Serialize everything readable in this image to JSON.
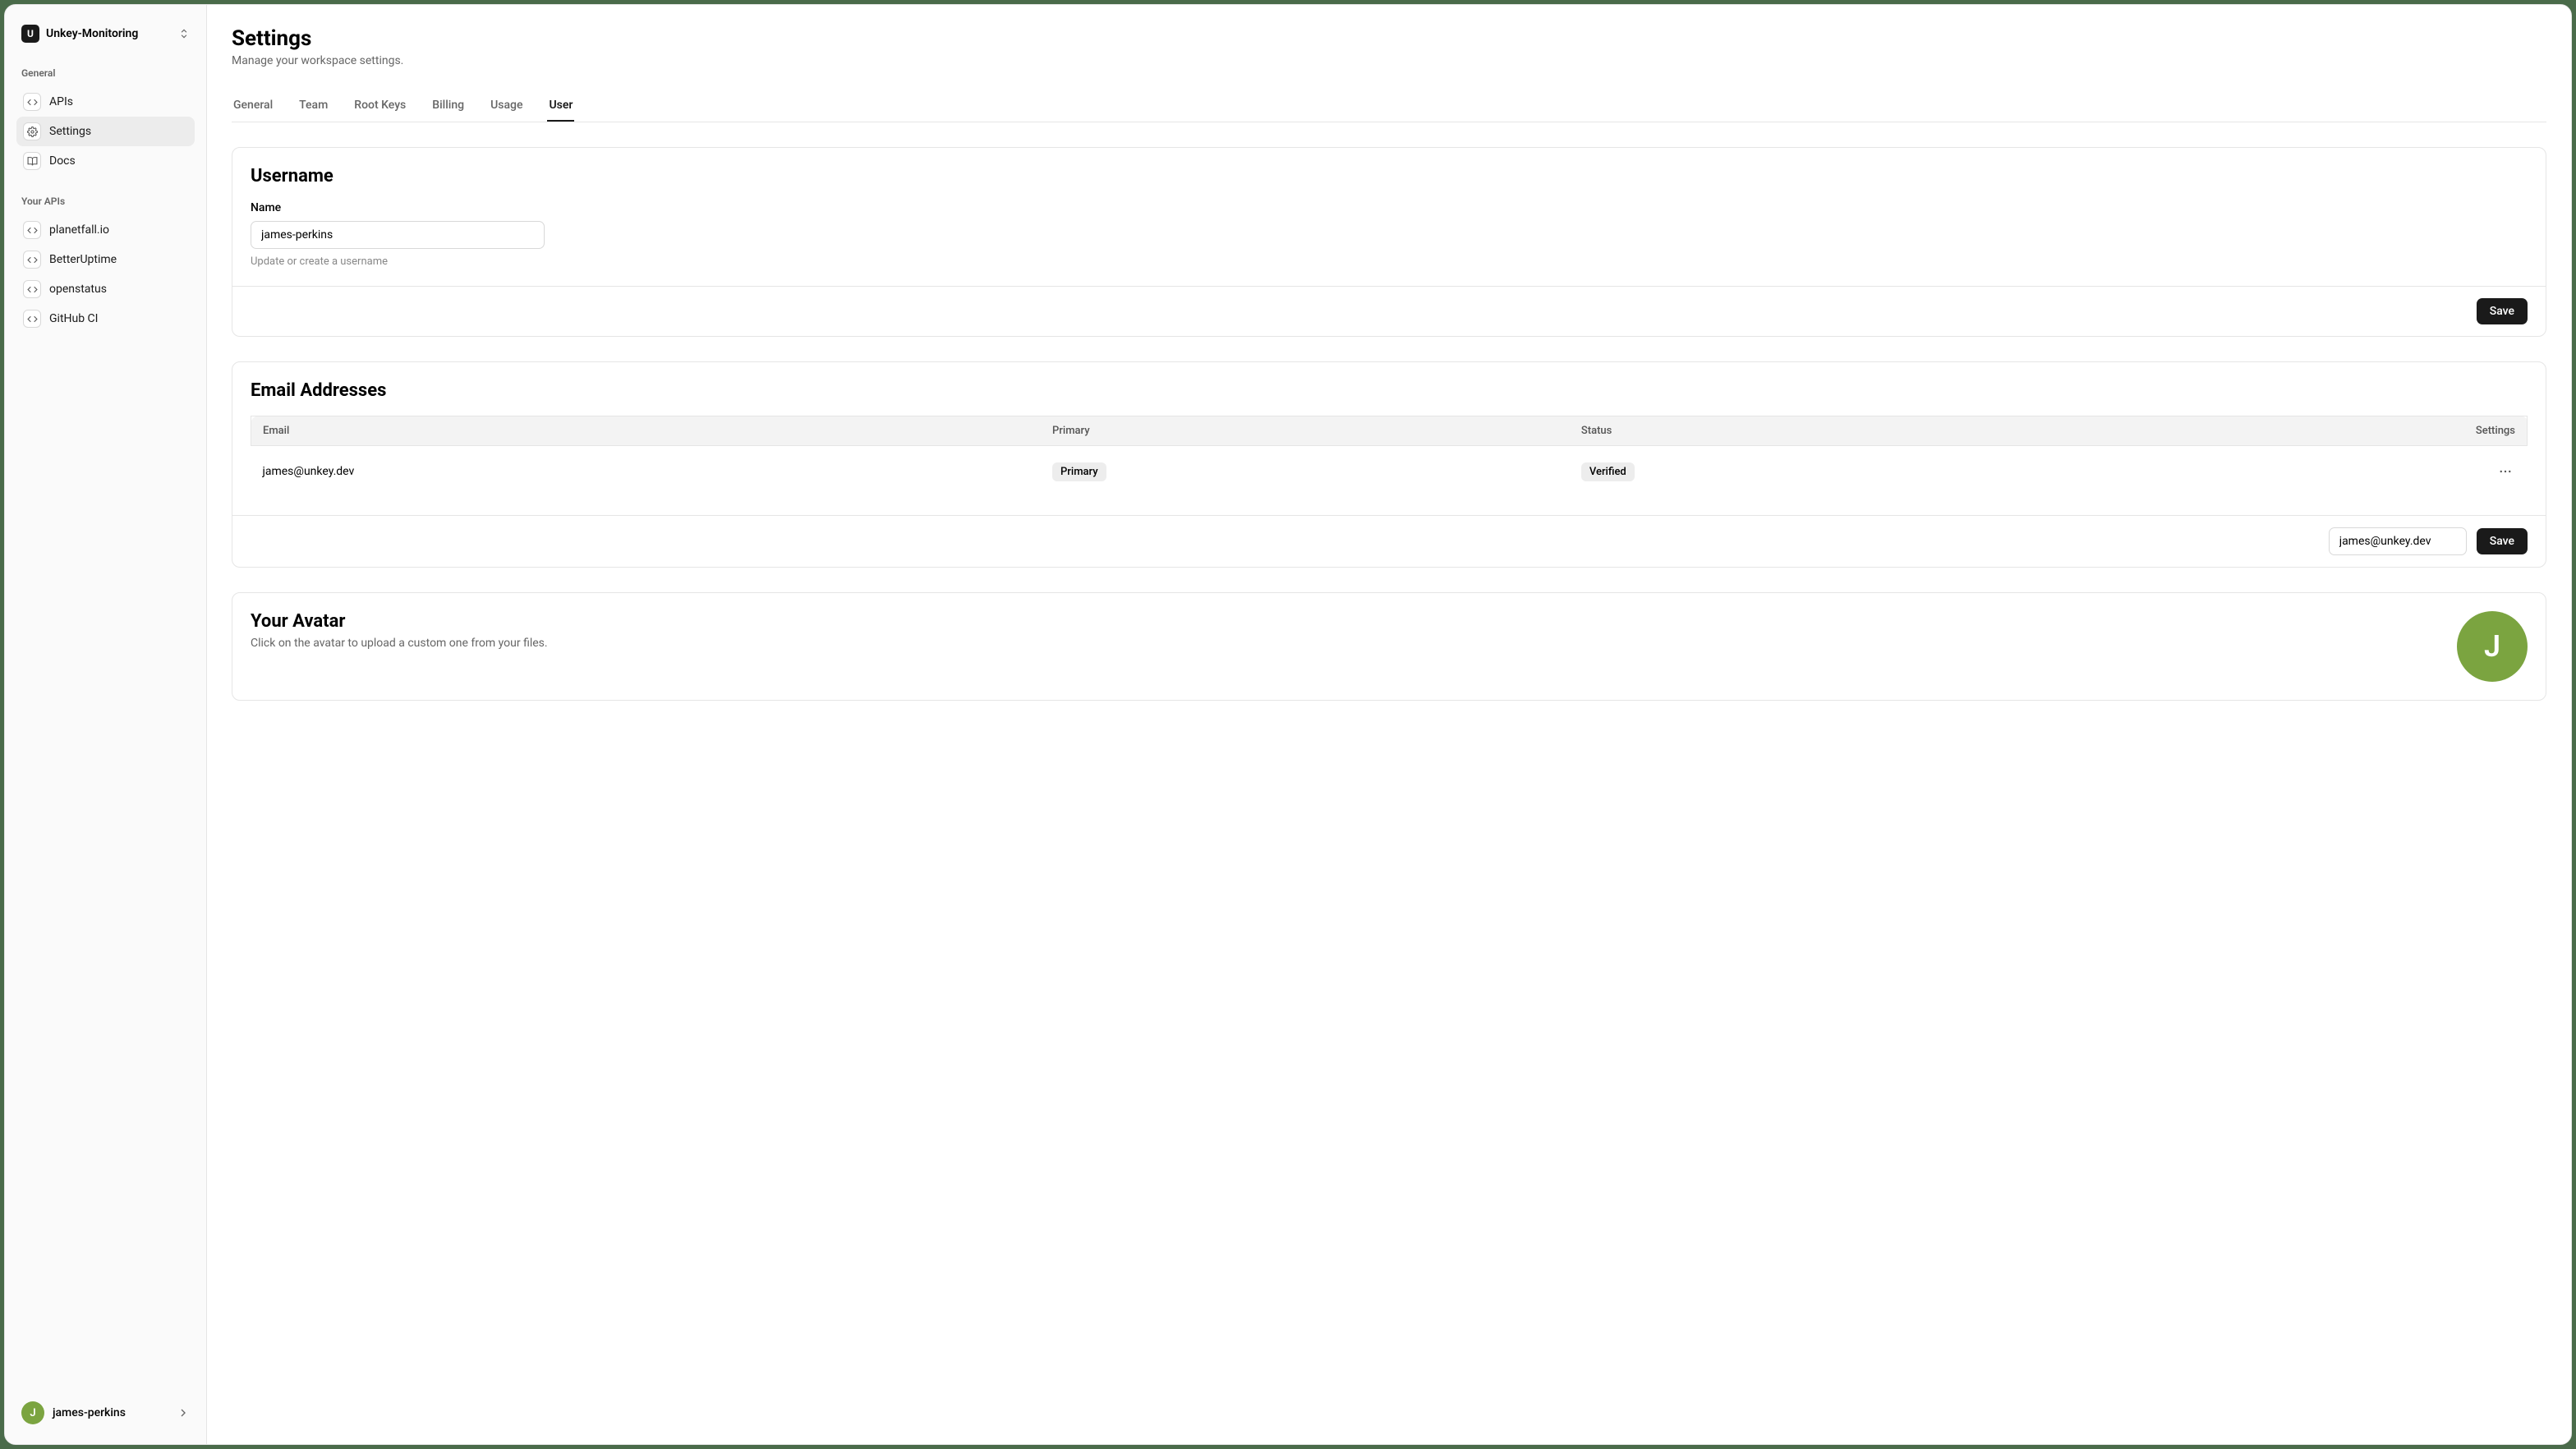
{
  "workspace": {
    "name": "Unkey-Monitoring",
    "logo_letter": "U"
  },
  "sidebar": {
    "section_general": "General",
    "items_general": [
      {
        "label": "APIs",
        "icon": "code"
      },
      {
        "label": "Settings",
        "icon": "gear",
        "active": true
      },
      {
        "label": "Docs",
        "icon": "book"
      }
    ],
    "section_apis": "Your APIs",
    "items_apis": [
      {
        "label": "planetfall.io"
      },
      {
        "label": "BetterUptime"
      },
      {
        "label": "openstatus"
      },
      {
        "label": "GitHub CI"
      }
    ]
  },
  "user_footer": {
    "name": "james-perkins",
    "initial": "J"
  },
  "page": {
    "title": "Settings",
    "subtitle": "Manage your workspace settings."
  },
  "tabs": [
    {
      "label": "General"
    },
    {
      "label": "Team"
    },
    {
      "label": "Root Keys"
    },
    {
      "label": "Billing"
    },
    {
      "label": "Usage"
    },
    {
      "label": "User",
      "active": true
    }
  ],
  "username_card": {
    "title": "Username",
    "field_label": "Name",
    "value": "james-perkins",
    "help": "Update or create a username",
    "save_label": "Save"
  },
  "email_card": {
    "title": "Email Addresses",
    "columns": {
      "email": "Email",
      "primary": "Primary",
      "status": "Status",
      "settings": "Settings"
    },
    "rows": [
      {
        "email": "james@unkey.dev",
        "primary_badge": "Primary",
        "status_badge": "Verified"
      }
    ],
    "new_email_value": "james@unkey.dev",
    "save_label": "Save"
  },
  "avatar_card": {
    "title": "Your Avatar",
    "subtitle": "Click on the avatar to upload a custom one from your files.",
    "initial": "J"
  },
  "colors": {
    "avatar_bg": "#7ba440",
    "primary_btn": "#1a1a1a"
  }
}
